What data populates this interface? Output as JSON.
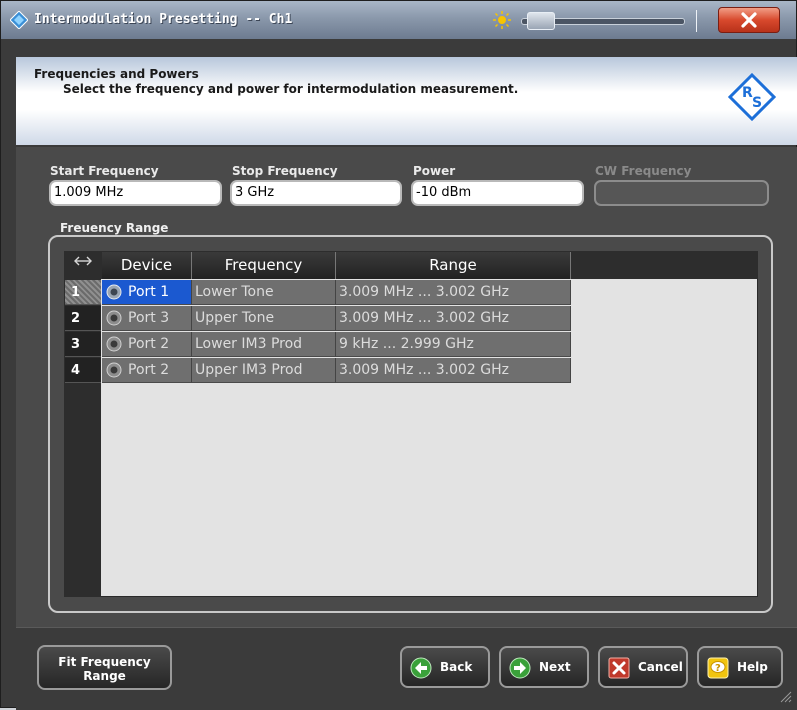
{
  "window": {
    "title": "Intermodulation Presetting -- Ch1"
  },
  "header": {
    "title": "Frequencies and Powers",
    "subtitle": "Select the frequency and power for intermodulation measurement."
  },
  "fields": {
    "start_frequency": {
      "label": "Start Frequency",
      "value": "1.009 MHz"
    },
    "stop_frequency": {
      "label": "Stop Frequency",
      "value": "3 GHz"
    },
    "power": {
      "label": "Power",
      "value": "-10 dBm"
    },
    "cw_frequency": {
      "label": "CW Frequency",
      "value": ""
    }
  },
  "range_group": {
    "label": "Freuency Range"
  },
  "table": {
    "columns": [
      "Device",
      "Frequency",
      "Range"
    ],
    "rows": [
      {
        "num": "1",
        "device": "Port 1",
        "frequency": "Lower Tone",
        "range": "3.009 MHz ... 3.002 GHz"
      },
      {
        "num": "2",
        "device": "Port 3",
        "frequency": "Upper Tone",
        "range": "3.009 MHz ... 3.002 GHz"
      },
      {
        "num": "3",
        "device": "Port 2",
        "frequency": "Lower IM3 Prod",
        "range": "9 kHz ... 2.999 GHz"
      },
      {
        "num": "4",
        "device": "Port 2",
        "frequency": "Upper IM3 Prod",
        "range": "3.009 MHz ... 3.002 GHz"
      }
    ],
    "selected_row": 1
  },
  "buttons": {
    "fit_line1": "Fit Frequency",
    "fit_line2": "Range",
    "back": "Back",
    "next": "Next",
    "cancel": "Cancel",
    "help": "Help"
  },
  "icons": {
    "app": "app-diamond-icon",
    "brightness": "sun-icon",
    "close": "close-icon",
    "logo": "rs-logo",
    "port": "port-connector-icon",
    "back": "back-arrow-icon",
    "next": "next-arrow-icon",
    "cancel": "cancel-x-icon",
    "help": "help-icon"
  },
  "colors": {
    "selection": "#1b59d0",
    "close_button": "#d8492d",
    "back_next_icon": "#3aa13a",
    "cancel_icon": "#c0392b",
    "help_icon": "#f1c40f"
  }
}
